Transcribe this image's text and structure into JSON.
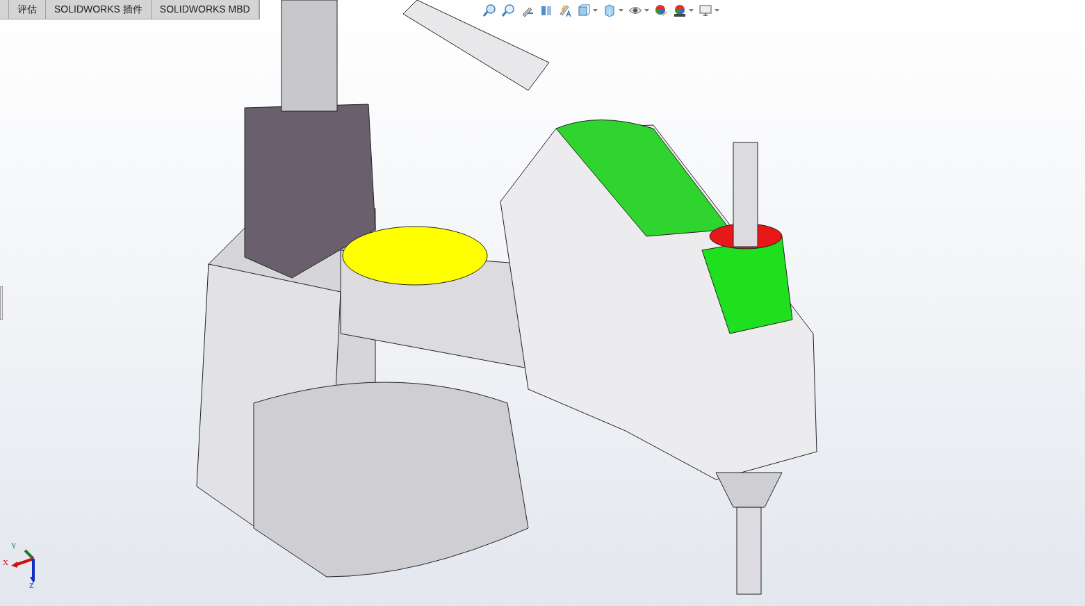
{
  "command_tabs": [
    {
      "label": "评估",
      "selected": false
    },
    {
      "label": "SOLIDWORKS 插件",
      "selected": false
    },
    {
      "label": "SOLIDWORKS MBD",
      "selected": false
    }
  ],
  "triad": {
    "x_label": "X",
    "y_label": "Y",
    "z_label": "Z"
  }
}
